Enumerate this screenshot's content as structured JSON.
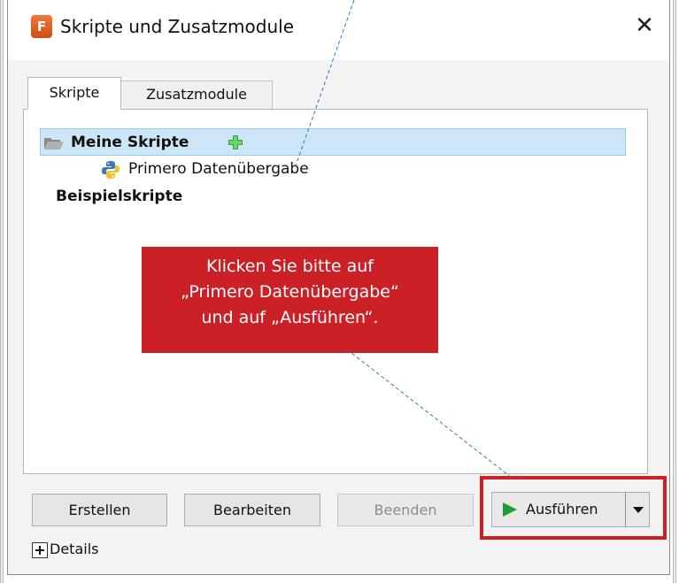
{
  "window": {
    "title": "Skripte und Zusatzmodule",
    "app_icon_letter": "F",
    "close_glyph": "✕"
  },
  "tabs": [
    {
      "label": "Skripte",
      "active": true
    },
    {
      "label": "Zusatzmodule",
      "active": false
    }
  ],
  "tree": {
    "items": [
      {
        "label": "Meine Skripte",
        "icon": "folder-open-icon",
        "selected": true,
        "has_add": true
      },
      {
        "label": "Primero Datenübergabe",
        "icon": "python-icon"
      },
      {
        "label": "Beispielskripte"
      }
    ]
  },
  "callout": {
    "lines": [
      "Klicken Sie bitte auf",
      "„Primero Datenübergabe“",
      "und auf „Ausführen“."
    ],
    "color": "#cc2027"
  },
  "buttons": {
    "create": "Erstellen",
    "edit": "Bearbeiten",
    "stop": "Beenden",
    "run": "Ausführen"
  },
  "details": {
    "label": "Details"
  },
  "colors": {
    "selection": "#cde6f7",
    "accent": "#cc2027",
    "play": "#1f9c3a"
  }
}
